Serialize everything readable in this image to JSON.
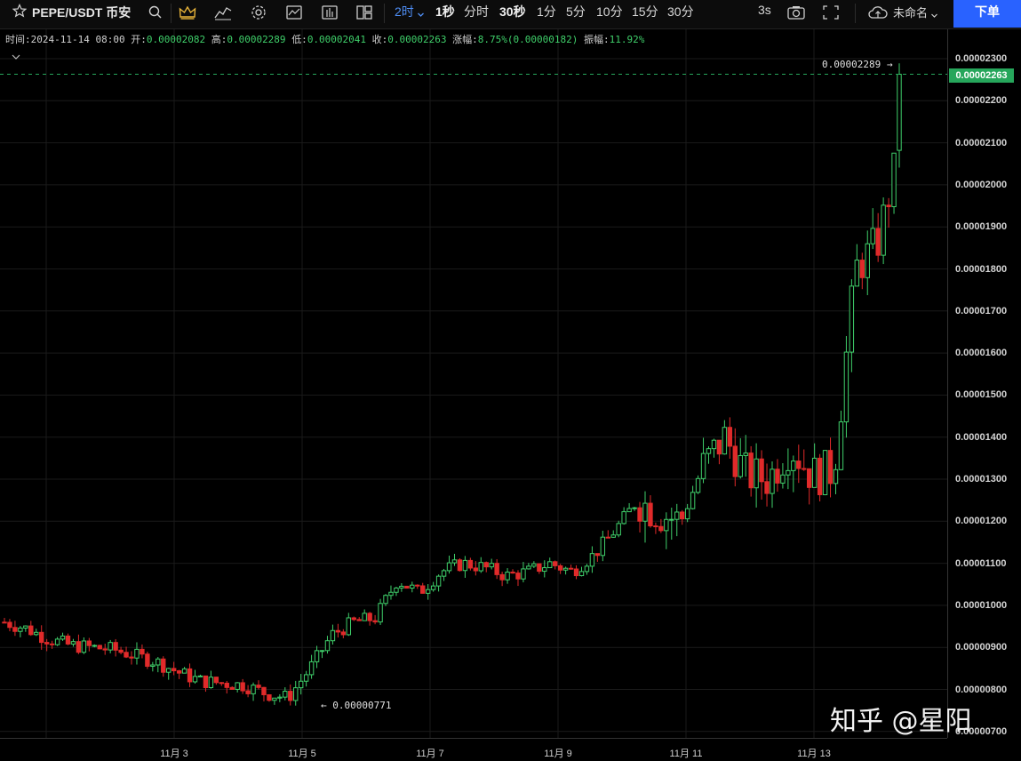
{
  "toolbar": {
    "symbol": "PEPE/USDT 币安",
    "intervals": [
      "2时",
      "1秒",
      "分时",
      "30秒",
      "1分",
      "5分",
      "10分",
      "15分",
      "30分"
    ],
    "right_interval": "3s",
    "layout_name": "未命名",
    "order_label": "下单"
  },
  "ohlc": {
    "time_label": "时间:",
    "time_value": "2024-11-14 08:00",
    "open_label": "开:",
    "open_value": "0.00002082",
    "high_label": "高:",
    "high_value": "0.00002289",
    "low_label": "低:",
    "low_value": "0.00002041",
    "close_label": "收:",
    "close_value": "0.00002263",
    "change_label": "涨幅:",
    "change_value": "8.75%(0.00000182)",
    "amplitude_label": "振幅:",
    "amplitude_value": "11.92%"
  },
  "price_axis": {
    "labels": [
      "0.00002300",
      "0.00002200",
      "0.00002100",
      "0.00002000",
      "0.00001900",
      "0.00001800",
      "0.00001700",
      "0.00001600",
      "0.00001500",
      "0.00001400",
      "0.00001300",
      "0.00001200",
      "0.00001100",
      "0.00001000",
      "0.00000900",
      "0.00000800",
      "0.00000700"
    ],
    "last_price": "0.00002263"
  },
  "time_axis": {
    "labels": [
      "11月 3",
      "11月 5",
      "11月 7",
      "11月 9",
      "11月 11",
      "11月 13"
    ]
  },
  "annotations": {
    "high_marker": "0.00002289 →",
    "low_marker": "← 0.00000771"
  },
  "watermark": "知乎 @星阳",
  "colors": {
    "up": "#3fcf6a",
    "down": "#e02a2a",
    "grid": "#1a1a1a",
    "accent": "#2962ff",
    "last_price_bg": "#26a65b"
  },
  "chart_data": {
    "type": "candlestick",
    "interval": "2时",
    "ylim": [
      7e-06,
      2.3e-05
    ],
    "y_ticks": [
      2.3e-05,
      2.2e-05,
      2.1e-05,
      2e-05,
      1.9e-05,
      1.8e-05,
      1.7e-05,
      1.6e-05,
      1.5e-05,
      1.4e-05,
      1.3e-05,
      1.2e-05,
      1.1e-05,
      1e-05,
      9e-06,
      8e-06,
      7e-06
    ],
    "x_tick_labels": [
      "11月 3",
      "11月 5",
      "11月 7",
      "11月 9",
      "11月 11",
      "11月 13"
    ],
    "approx_close_path": [
      9.6e-06,
      9.45e-06,
      9.2e-06,
      9.05e-06,
      9e-06,
      8.95e-06,
      8.8e-06,
      8.65e-06,
      8.4e-06,
      8.2e-06,
      8.15e-06,
      8.1e-06,
      7.9e-06,
      7.8e-06,
      8.5e-06,
      9.3e-06,
      9.6e-06,
      9.7e-06,
      1.06e-05,
      1.03e-05,
      1.08e-05,
      1.1e-05,
      1.09e-05,
      1.07e-05,
      1.08e-05,
      1.1e-05,
      1.08e-05,
      1.12e-05,
      1.18e-05,
      1.25e-05,
      1.22e-05,
      1.2e-05,
      1.33e-05,
      1.4e-05,
      1.31e-05,
      1.3e-05,
      1.38e-05,
      1.31e-05,
      1.32e-05,
      1.8e-05,
      1.86e-05,
      2.082e-05
    ],
    "last_candle": {
      "time": "2024-11-14 08:00",
      "open": 2.082e-05,
      "high": 2.289e-05,
      "low": 2.041e-05,
      "close": 2.263e-05
    },
    "period_high": 2.289e-05,
    "period_low": 7.71e-06,
    "last_price": 2.263e-05
  }
}
